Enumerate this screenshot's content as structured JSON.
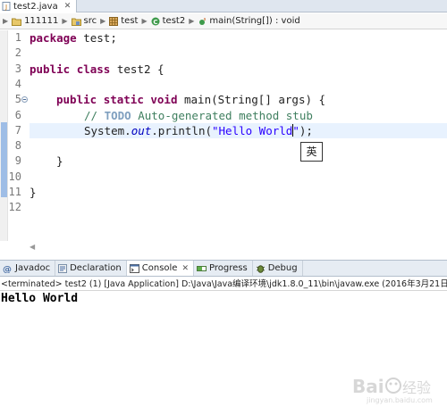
{
  "editor": {
    "tab_label": "test2.java",
    "tab_close": "✕"
  },
  "breadcrumb": {
    "project": "111111",
    "src": "src",
    "package": "test",
    "class": "test2",
    "method": "main(String[]) : void"
  },
  "code": {
    "line_numbers": [
      "1",
      "2",
      "3",
      "4",
      "5",
      "6",
      "7",
      "8",
      "9",
      "10",
      "11",
      "12"
    ],
    "l1_kw": "package",
    "l1_rest": " test;",
    "l3_kw1": "public",
    "l3_kw2": "class",
    "l3_rest": " test2 {",
    "l5_kw1": "public",
    "l5_kw2": "static",
    "l5_kw3": "void",
    "l5_rest": " main(String[] args) {",
    "l6_comment": "// ",
    "l6_todo": "TODO",
    "l6_rest": " Auto-generated method stub",
    "l7_a": "System.",
    "l7_field": "out",
    "l7_b": ".println(",
    "l7_string_before_caret": "\"Hello World",
    "l7_string_after_caret": "\"",
    "l7_end": ");",
    "l9": "}",
    "l11": "}"
  },
  "ime": {
    "char": "英"
  },
  "views": {
    "tabs": [
      "Javadoc",
      "Declaration",
      "Console",
      "Progress",
      "Debug"
    ],
    "close": "✕"
  },
  "console": {
    "status": "<terminated> test2 (1) [Java Application] D:\\Java\\Java编译环境\\jdk1.8.0_11\\bin\\javaw.exe (2016年3月21日 下午1:",
    "output": "Hello World"
  },
  "watermark": {
    "text": "Bai经验",
    "sub": "jingyan.baidu.com"
  },
  "colors": {
    "keyword": "#7f0055",
    "comment": "#3f7f5f",
    "string": "#2a00ff",
    "field": "#0000c0",
    "current_line": "#e8f2fe"
  }
}
